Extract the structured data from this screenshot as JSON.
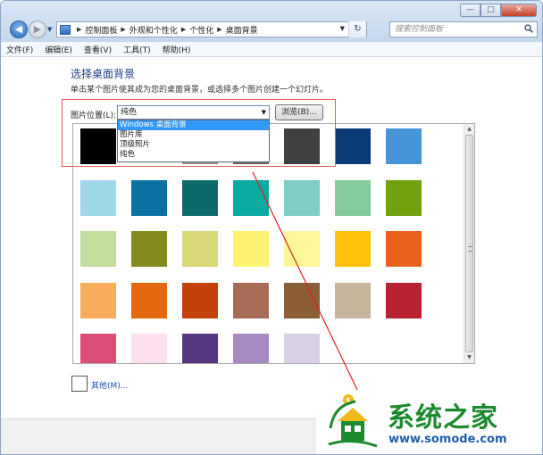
{
  "window": {
    "minimize": "—",
    "maximize": "□",
    "close": "✕"
  },
  "address_bar": {
    "breadcrumbs": [
      "控制面板",
      "外观和个性化",
      "个性化",
      "桌面背景"
    ],
    "search_placeholder": "搜索控制面板"
  },
  "menu": {
    "items": [
      "文件(F)",
      "编辑(E)",
      "查看(V)",
      "工具(T)",
      "帮助(H)"
    ]
  },
  "main": {
    "heading": "选择桌面背景",
    "subtext": "单击某个图片使其成为您的桌面背景，或选择多个图片创建一个幻灯片。",
    "location_label": "图片位置(L):",
    "location_value": "纯色",
    "browse_label": "浏览(B)...",
    "dropdown_options": [
      "Windows 桌面背景",
      "图片库",
      "顶级照片",
      "纯色"
    ],
    "dropdown_selected_index": 0,
    "other_label": "其他(M)..."
  },
  "gallery": {
    "rows": [
      [
        "#000000",
        "#ffffff",
        "#8f8f8f",
        "#666666",
        "#404040",
        "#0a3a78",
        "#4595d8"
      ],
      [
        "#9ed8ea",
        "#0a72a2",
        "#0c6a6a",
        "#0aaaa0",
        "#7ecdc6",
        "#86cb9c",
        "#72a10e"
      ],
      [
        "#c3de9c",
        "#858a1c",
        "#d8d87a",
        "#fcf274",
        "#fdf79a",
        "#fec20e",
        "#e8621c"
      ],
      [
        "#f9ad5c",
        "#e5680e",
        "#c4400a",
        "#a76c55",
        "#8c5e37",
        "#c8b49c",
        "#b92231"
      ],
      [
        "#dc4e78",
        "#fde1ee",
        "#553881",
        "#a88ac3",
        "#d8d0e5"
      ]
    ]
  },
  "watermark": {
    "name": "系统之家",
    "url": "www.somode.com"
  }
}
